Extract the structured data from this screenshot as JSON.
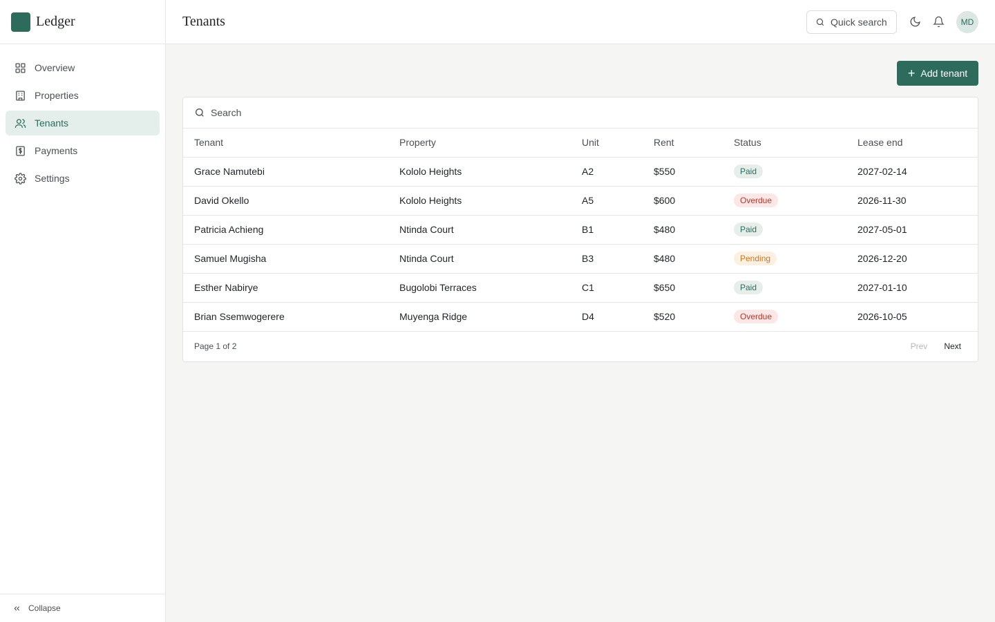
{
  "brand": {
    "name": "Ledger",
    "logo_color": "#2d6b5c"
  },
  "sidebar": {
    "items": [
      {
        "label": "Overview",
        "icon": "grid-icon"
      },
      {
        "label": "Properties",
        "icon": "building-icon"
      },
      {
        "label": "Tenants",
        "icon": "users-icon",
        "active": true
      },
      {
        "label": "Payments",
        "icon": "receipt-icon"
      },
      {
        "label": "Settings",
        "icon": "gear-icon"
      }
    ],
    "collapse_label": "Collapse"
  },
  "header": {
    "title": "Tenants",
    "quick_search_label": "Quick search",
    "avatar_initials": "MD"
  },
  "actions": {
    "add_tenant_label": "Add tenant"
  },
  "table": {
    "search_placeholder": "Search",
    "columns": [
      "Tenant",
      "Property",
      "Unit",
      "Rent",
      "Status",
      "Lease end"
    ],
    "rows": [
      {
        "tenant": "Grace Namutebi",
        "property": "Kololo Heights",
        "unit": "A2",
        "rent": "$550",
        "status": "Paid",
        "lease_end": "2027-02-14"
      },
      {
        "tenant": "David Okello",
        "property": "Kololo Heights",
        "unit": "A5",
        "rent": "$600",
        "status": "Overdue",
        "lease_end": "2026-11-30"
      },
      {
        "tenant": "Patricia Achieng",
        "property": "Ntinda Court",
        "unit": "B1",
        "rent": "$480",
        "status": "Paid",
        "lease_end": "2027-05-01"
      },
      {
        "tenant": "Samuel Mugisha",
        "property": "Ntinda Court",
        "unit": "B3",
        "rent": "$480",
        "status": "Pending",
        "lease_end": "2026-12-20"
      },
      {
        "tenant": "Esther Nabirye",
        "property": "Bugolobi Terraces",
        "unit": "C1",
        "rent": "$650",
        "status": "Paid",
        "lease_end": "2027-01-10"
      },
      {
        "tenant": "Brian Ssemwogerere",
        "property": "Muyenga Ridge",
        "unit": "D4",
        "rent": "$520",
        "status": "Overdue",
        "lease_end": "2026-10-05"
      }
    ],
    "page_info": "Page 1 of 2",
    "prev_label": "Prev",
    "next_label": "Next"
  },
  "colors": {
    "accent": "#2d6b5c",
    "paid": "#2d6b5c",
    "overdue": "#b23a2e",
    "pending": "#c47a26"
  }
}
